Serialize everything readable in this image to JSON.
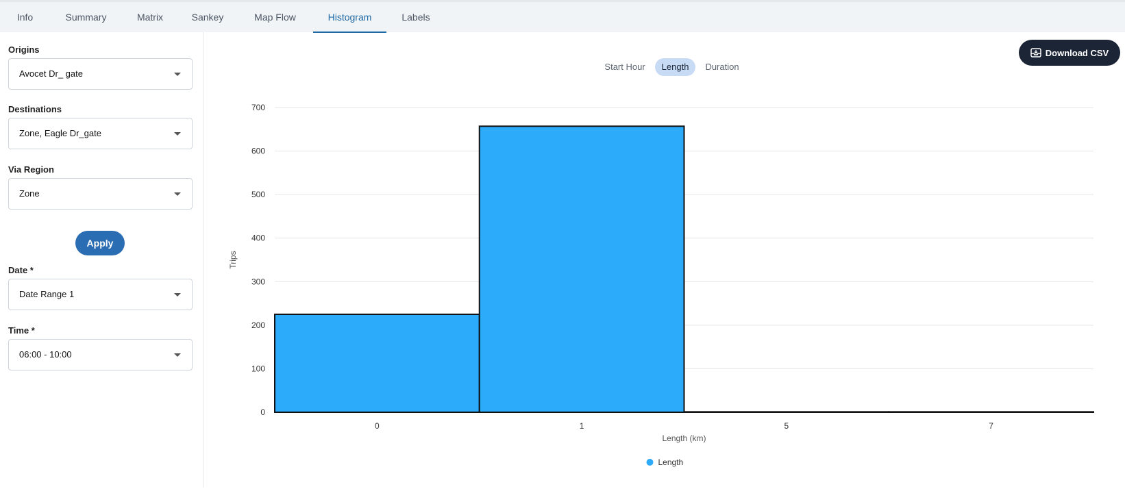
{
  "tabs": [
    {
      "label": "Info",
      "active": false
    },
    {
      "label": "Summary",
      "active": false
    },
    {
      "label": "Matrix",
      "active": false
    },
    {
      "label": "Sankey",
      "active": false
    },
    {
      "label": "Map Flow",
      "active": false
    },
    {
      "label": "Histogram",
      "active": true
    },
    {
      "label": "Labels",
      "active": false
    }
  ],
  "sidebar": {
    "origins": {
      "label": "Origins",
      "value": "Avocet Dr_ gate"
    },
    "destinations": {
      "label": "Destinations",
      "value": "Zone, Eagle Dr_gate"
    },
    "via_region": {
      "label": "Via Region",
      "value": "Zone"
    },
    "apply_label": "Apply",
    "date": {
      "label": "Date *",
      "value": "Date Range 1"
    },
    "time": {
      "label": "Time *",
      "value": "06:00 - 10:00"
    }
  },
  "toolbar": {
    "download_label": "Download CSV",
    "download_icon": "inbox-download-icon",
    "metric_options": [
      {
        "label": "Start Hour",
        "active": false
      },
      {
        "label": "Length",
        "active": true
      },
      {
        "label": "Duration",
        "active": false
      }
    ]
  },
  "colors": {
    "accent": "#1f6aa5",
    "bar": "#2babfa",
    "button_dark": "#1c2535",
    "apply": "#2a6db3"
  },
  "chart_data": {
    "type": "bar",
    "categories": [
      "0",
      "1",
      "5",
      "7"
    ],
    "series": [
      {
        "name": "Length",
        "values": [
          225,
          657,
          1,
          1
        ]
      }
    ],
    "xlabel": "Length (km)",
    "ylabel": "Trips",
    "ylim": [
      0,
      700
    ],
    "yticks": [
      0,
      100,
      200,
      300,
      400,
      500,
      600,
      700
    ],
    "grid": true,
    "legend": "bottom-center"
  }
}
